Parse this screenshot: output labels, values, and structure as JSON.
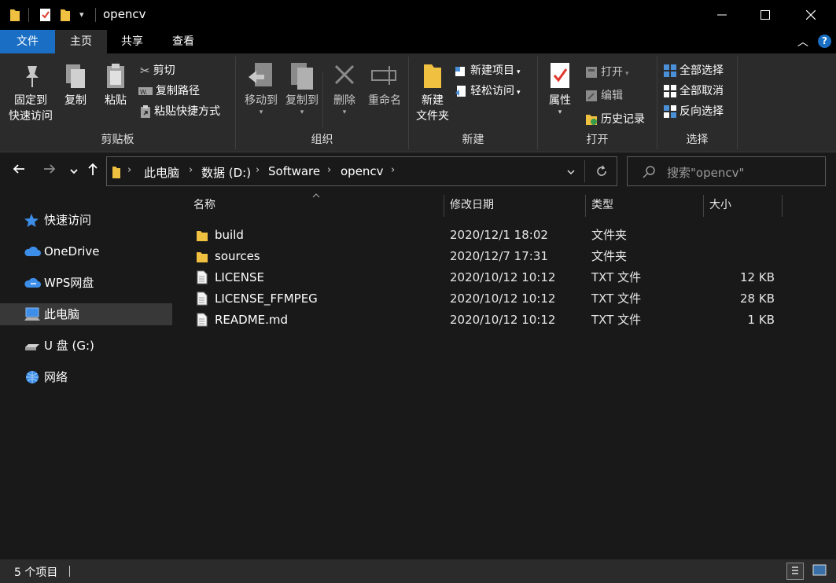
{
  "window": {
    "title": "opencv",
    "controls": [
      "minimize-icon",
      "maximize-icon",
      "close-icon"
    ]
  },
  "ribbon_tabs": [
    {
      "label": "文件"
    },
    {
      "label": "主页"
    },
    {
      "label": "共享"
    },
    {
      "label": "查看"
    }
  ],
  "ribbon": {
    "clipboard": {
      "label": "剪贴板",
      "pin_line1": "固定到",
      "pin_line2": "快速访问",
      "copy": "复制",
      "paste": "粘贴",
      "cut": "剪切",
      "copy_path": "复制路径",
      "paste_shortcut": "粘贴快捷方式"
    },
    "organize": {
      "label": "组织",
      "move_to": "移动到",
      "copy_to": "复制到",
      "delete": "删除",
      "rename": "重命名"
    },
    "new": {
      "label": "新建",
      "new_folder_line1": "新建",
      "new_folder_line2": "文件夹",
      "new_item": "新建项目",
      "easy_access": "轻松访问"
    },
    "open": {
      "label": "打开",
      "properties": "属性",
      "open": "打开",
      "edit": "编辑",
      "history": "历史记录"
    },
    "select": {
      "label": "选择",
      "select_all": "全部选择",
      "select_none": "全部取消",
      "invert": "反向选择"
    }
  },
  "address": {
    "breadcrumbs": [
      "此电脑",
      "数据 (D:)",
      "Software",
      "opencv"
    ],
    "search_placeholder": "搜索\"opencv\""
  },
  "nav_pane": [
    {
      "label": "快速访问",
      "icon": "star-icon"
    },
    {
      "label": "OneDrive",
      "icon": "cloud-icon"
    },
    {
      "label": "WPS网盘",
      "icon": "cloud-icon"
    },
    {
      "label": "此电脑",
      "icon": "computer-icon",
      "selected": true
    },
    {
      "label": "U 盘 (G:)",
      "icon": "usb-drive-icon"
    },
    {
      "label": "网络",
      "icon": "network-icon"
    }
  ],
  "columns": {
    "name": "名称",
    "modified": "修改日期",
    "type": "类型",
    "size": "大小"
  },
  "files": [
    {
      "name": "build",
      "modified": "2020/12/1 18:02",
      "type": "文件夹",
      "size": "",
      "icon": "folder-icon"
    },
    {
      "name": "sources",
      "modified": "2020/12/7 17:31",
      "type": "文件夹",
      "size": "",
      "icon": "folder-icon"
    },
    {
      "name": "LICENSE",
      "modified": "2020/10/12 10:12",
      "type": "TXT 文件",
      "size": "12 KB",
      "icon": "text-file-icon"
    },
    {
      "name": "LICENSE_FFMPEG",
      "modified": "2020/10/12 10:12",
      "type": "TXT 文件",
      "size": "28 KB",
      "icon": "text-file-icon"
    },
    {
      "name": "README.md",
      "modified": "2020/10/12 10:12",
      "type": "TXT 文件",
      "size": "1 KB",
      "icon": "text-file-icon"
    }
  ],
  "status": {
    "item_count": "5 个项目"
  }
}
